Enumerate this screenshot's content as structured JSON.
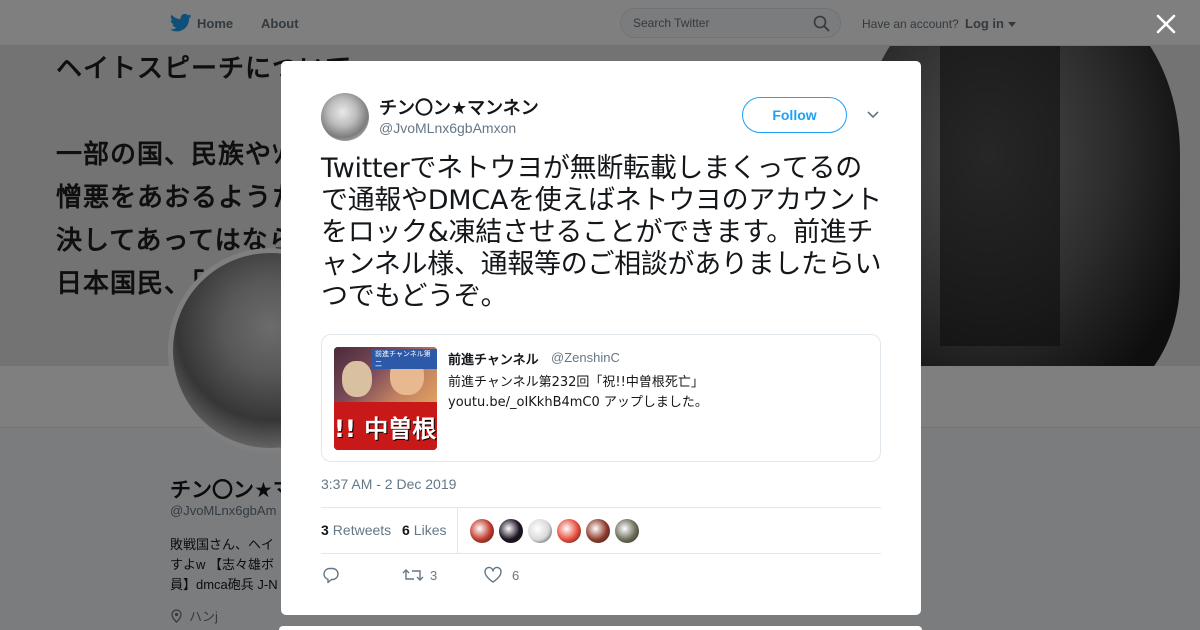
{
  "topnav": {
    "home_label": "Home",
    "about_label": "About",
    "search_placeholder": "Search Twitter",
    "have_account": "Have an account?",
    "login_label": "Log in"
  },
  "banner": {
    "lines": [
      "ヘイトスピーチについて",
      "一部の国、民族やｿ",
      "憎悪をあおるようた",
      "決してあってはなら",
      "日本国民、「"
    ]
  },
  "profile": {
    "name": "チン〇ン★マ",
    "handle": "@JvoMLnx6gbAm",
    "bio": "敗戦国さん、ヘイ すよw 【志々雄ボ 員】dmca砲兵 J-N",
    "location": "ハンj"
  },
  "tweet": {
    "author_name": "チン〇ン★マンネン",
    "author_handle": "@JvoMLnx6gbAmxon",
    "follow_label": "Follow",
    "text": "Twitterでネトウヨが無断転載しまくってるので通報やDMCAを使えばネトウヨのアカウントをロック&凍結させることができます。前進チャンネル様、通報等のご相談がありましたらいつでもどうぞ。",
    "timestamp": "3:37 AM - 2 Dec 2019",
    "retweets_count": "3",
    "retweets_label": "Retweets",
    "likes_count": "6",
    "likes_label": "Likes",
    "action_retweet_count": "3",
    "action_like_count": "6"
  },
  "quote": {
    "name": "前進チャンネル",
    "handle": "@ZenshinC",
    "line1": "前進チャンネル第232回「祝!!中曽根死亡」",
    "line2": "youtu.be/_oIKkhB4mC0 アップしました。",
    "thumb_text": "!! 中曽根",
    "thumb_label": "前進チャンネル第二"
  },
  "likers": [
    {
      "color": "#c0392b"
    },
    {
      "color": "#1a1020"
    },
    {
      "color": "#d9d9d9"
    },
    {
      "color": "#e74c3c"
    },
    {
      "color": "#8e3b2a"
    },
    {
      "color": "#6d6d5a"
    }
  ],
  "colors": {
    "accent": "#1da1f2",
    "muted": "#657786",
    "border": "#e1e8ed"
  },
  "icons": [
    "twitter-bird-icon",
    "search-icon",
    "close-icon",
    "chevron-down-icon",
    "reply-icon",
    "retweet-icon",
    "heart-icon",
    "location-pin-icon"
  ]
}
